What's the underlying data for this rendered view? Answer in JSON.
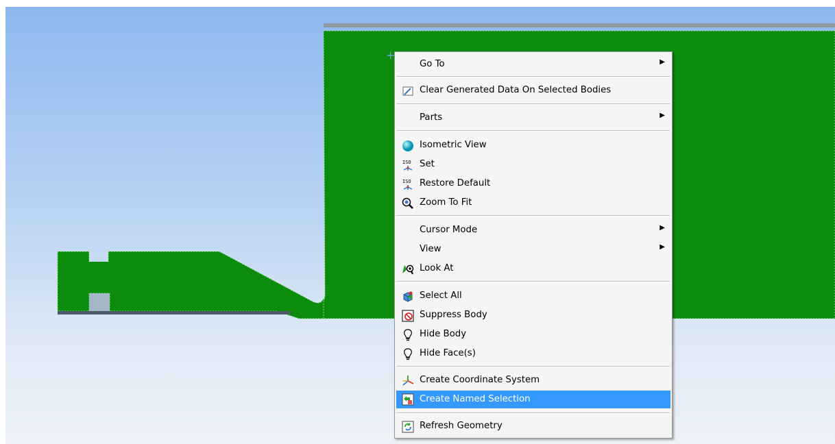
{
  "menu": {
    "go_to": "Go To",
    "clear_generated": "Clear Generated Data On Selected Bodies",
    "parts": "Parts",
    "isometric_view": "Isometric View",
    "set": "Set",
    "restore_default": "Restore Default",
    "zoom_to_fit": "Zoom To Fit",
    "cursor_mode": "Cursor Mode",
    "view": "View",
    "look_at": "Look At",
    "select_all": "Select All",
    "suppress_body": "Suppress Body",
    "hide_body": "Hide Body",
    "hide_faces": "Hide Face(s)",
    "create_coordinate_system": "Create Coordinate System",
    "create_named_selection": "Create Named Selection",
    "refresh_geometry": "Refresh Geometry",
    "submenu_arrow": "▶",
    "highlighted_item": "Create Named Selection"
  },
  "icons": {
    "clear": "eraser-icon",
    "isometric": "sphere-icon",
    "set": "iso-axes-icon",
    "restore": "iso-axes-icon",
    "zoom": "magnifier-icon",
    "look_at": "look-at-icon",
    "select_all": "cube-select-icon",
    "suppress": "suppress-icon",
    "hide_body": "lightbulb-icon",
    "hide_faces": "lightbulb-icon",
    "coordinate": "triad-icon",
    "named_sel": "named-selection-icon",
    "refresh": "refresh-icon"
  },
  "colors": {
    "body_green": "#0c8c0c",
    "highlight": "#3399ff",
    "menu_bg": "#f5f5f5"
  }
}
